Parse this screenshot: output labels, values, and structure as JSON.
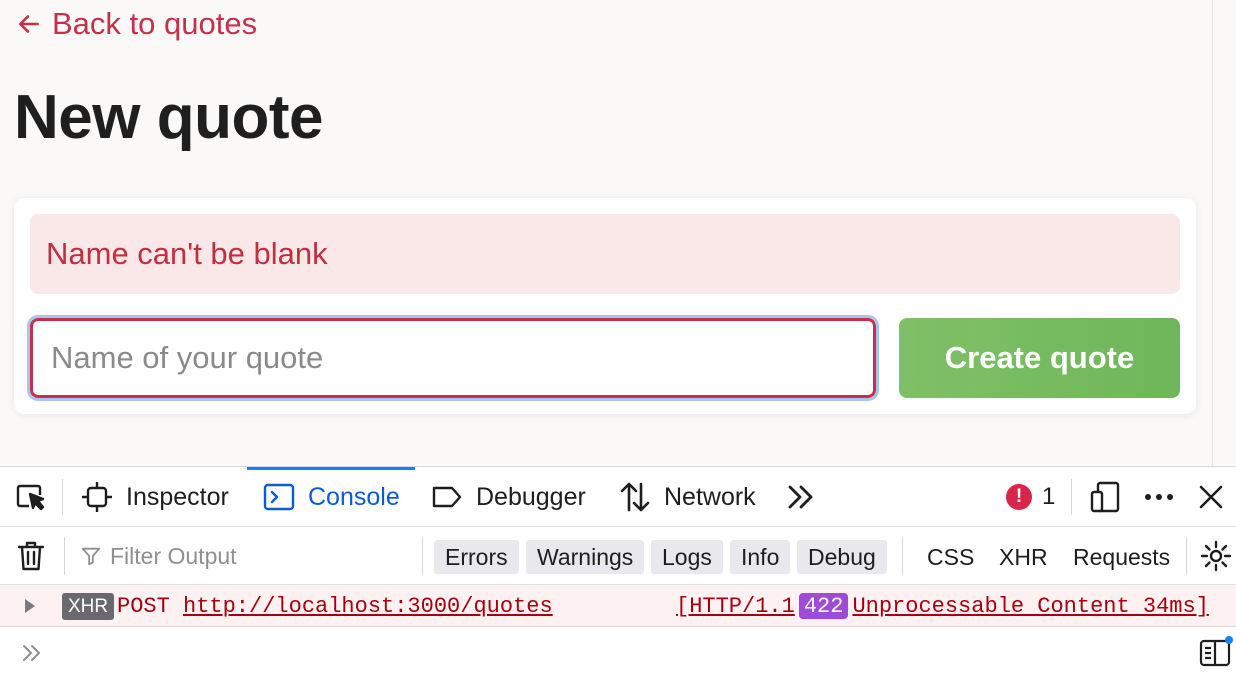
{
  "page": {
    "back_link": "Back to quotes",
    "title": "New quote",
    "error_message": "Name can't be blank",
    "name_input": {
      "value": "",
      "placeholder": "Name of your quote"
    },
    "submit_label": "Create quote"
  },
  "devtools": {
    "tabs": [
      {
        "label": "Inspector",
        "icon": "inspector-icon"
      },
      {
        "label": "Console",
        "icon": "console-icon",
        "active": true
      },
      {
        "label": "Debugger",
        "icon": "debugger-icon"
      },
      {
        "label": "Network",
        "icon": "network-icon"
      }
    ],
    "error_count": "1",
    "filter_placeholder": "Filter Output",
    "levels": [
      "Errors",
      "Warnings",
      "Logs",
      "Info",
      "Debug"
    ],
    "extra_filters": [
      "CSS",
      "XHR",
      "Requests"
    ],
    "log": {
      "type": "XHR",
      "method": "POST",
      "url": "http://localhost:3000/quotes",
      "protocol": "[HTTP/1.1",
      "status_code": "422",
      "status_text": "Unprocessable Content 34ms]"
    }
  },
  "colors": {
    "accent": "#c6304a",
    "error_bg": "#fae7e7",
    "button_green": "#7fc067",
    "console_blue": "#0a5cd0",
    "status_purple": "#9f4bd7"
  }
}
